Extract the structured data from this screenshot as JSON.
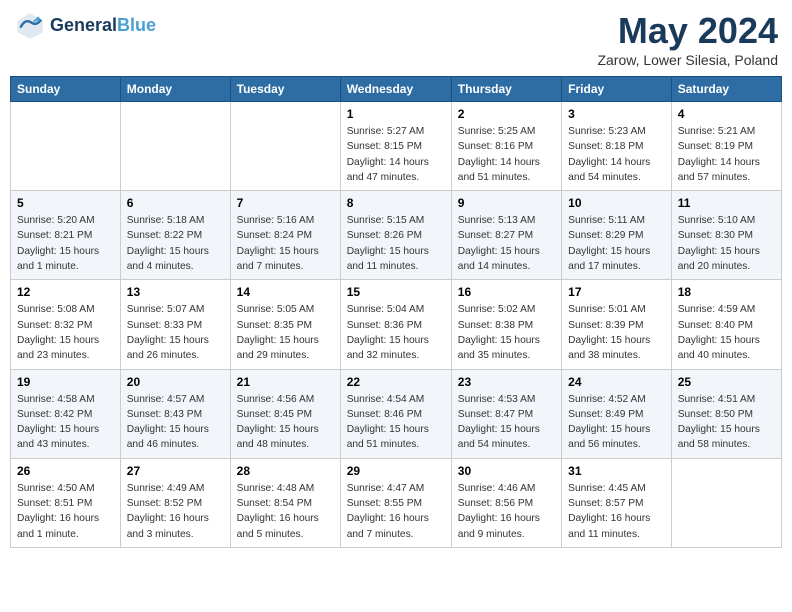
{
  "header": {
    "logo_line1": "General",
    "logo_line2": "Blue",
    "month": "May 2024",
    "location": "Zarow, Lower Silesia, Poland"
  },
  "weekdays": [
    "Sunday",
    "Monday",
    "Tuesday",
    "Wednesday",
    "Thursday",
    "Friday",
    "Saturday"
  ],
  "weeks": [
    [
      {
        "day": "",
        "info": ""
      },
      {
        "day": "",
        "info": ""
      },
      {
        "day": "",
        "info": ""
      },
      {
        "day": "1",
        "info": "Sunrise: 5:27 AM\nSunset: 8:15 PM\nDaylight: 14 hours\nand 47 minutes."
      },
      {
        "day": "2",
        "info": "Sunrise: 5:25 AM\nSunset: 8:16 PM\nDaylight: 14 hours\nand 51 minutes."
      },
      {
        "day": "3",
        "info": "Sunrise: 5:23 AM\nSunset: 8:18 PM\nDaylight: 14 hours\nand 54 minutes."
      },
      {
        "day": "4",
        "info": "Sunrise: 5:21 AM\nSunset: 8:19 PM\nDaylight: 14 hours\nand 57 minutes."
      }
    ],
    [
      {
        "day": "5",
        "info": "Sunrise: 5:20 AM\nSunset: 8:21 PM\nDaylight: 15 hours\nand 1 minute."
      },
      {
        "day": "6",
        "info": "Sunrise: 5:18 AM\nSunset: 8:22 PM\nDaylight: 15 hours\nand 4 minutes."
      },
      {
        "day": "7",
        "info": "Sunrise: 5:16 AM\nSunset: 8:24 PM\nDaylight: 15 hours\nand 7 minutes."
      },
      {
        "day": "8",
        "info": "Sunrise: 5:15 AM\nSunset: 8:26 PM\nDaylight: 15 hours\nand 11 minutes."
      },
      {
        "day": "9",
        "info": "Sunrise: 5:13 AM\nSunset: 8:27 PM\nDaylight: 15 hours\nand 14 minutes."
      },
      {
        "day": "10",
        "info": "Sunrise: 5:11 AM\nSunset: 8:29 PM\nDaylight: 15 hours\nand 17 minutes."
      },
      {
        "day": "11",
        "info": "Sunrise: 5:10 AM\nSunset: 8:30 PM\nDaylight: 15 hours\nand 20 minutes."
      }
    ],
    [
      {
        "day": "12",
        "info": "Sunrise: 5:08 AM\nSunset: 8:32 PM\nDaylight: 15 hours\nand 23 minutes."
      },
      {
        "day": "13",
        "info": "Sunrise: 5:07 AM\nSunset: 8:33 PM\nDaylight: 15 hours\nand 26 minutes."
      },
      {
        "day": "14",
        "info": "Sunrise: 5:05 AM\nSunset: 8:35 PM\nDaylight: 15 hours\nand 29 minutes."
      },
      {
        "day": "15",
        "info": "Sunrise: 5:04 AM\nSunset: 8:36 PM\nDaylight: 15 hours\nand 32 minutes."
      },
      {
        "day": "16",
        "info": "Sunrise: 5:02 AM\nSunset: 8:38 PM\nDaylight: 15 hours\nand 35 minutes."
      },
      {
        "day": "17",
        "info": "Sunrise: 5:01 AM\nSunset: 8:39 PM\nDaylight: 15 hours\nand 38 minutes."
      },
      {
        "day": "18",
        "info": "Sunrise: 4:59 AM\nSunset: 8:40 PM\nDaylight: 15 hours\nand 40 minutes."
      }
    ],
    [
      {
        "day": "19",
        "info": "Sunrise: 4:58 AM\nSunset: 8:42 PM\nDaylight: 15 hours\nand 43 minutes."
      },
      {
        "day": "20",
        "info": "Sunrise: 4:57 AM\nSunset: 8:43 PM\nDaylight: 15 hours\nand 46 minutes."
      },
      {
        "day": "21",
        "info": "Sunrise: 4:56 AM\nSunset: 8:45 PM\nDaylight: 15 hours\nand 48 minutes."
      },
      {
        "day": "22",
        "info": "Sunrise: 4:54 AM\nSunset: 8:46 PM\nDaylight: 15 hours\nand 51 minutes."
      },
      {
        "day": "23",
        "info": "Sunrise: 4:53 AM\nSunset: 8:47 PM\nDaylight: 15 hours\nand 54 minutes."
      },
      {
        "day": "24",
        "info": "Sunrise: 4:52 AM\nSunset: 8:49 PM\nDaylight: 15 hours\nand 56 minutes."
      },
      {
        "day": "25",
        "info": "Sunrise: 4:51 AM\nSunset: 8:50 PM\nDaylight: 15 hours\nand 58 minutes."
      }
    ],
    [
      {
        "day": "26",
        "info": "Sunrise: 4:50 AM\nSunset: 8:51 PM\nDaylight: 16 hours\nand 1 minute."
      },
      {
        "day": "27",
        "info": "Sunrise: 4:49 AM\nSunset: 8:52 PM\nDaylight: 16 hours\nand 3 minutes."
      },
      {
        "day": "28",
        "info": "Sunrise: 4:48 AM\nSunset: 8:54 PM\nDaylight: 16 hours\nand 5 minutes."
      },
      {
        "day": "29",
        "info": "Sunrise: 4:47 AM\nSunset: 8:55 PM\nDaylight: 16 hours\nand 7 minutes."
      },
      {
        "day": "30",
        "info": "Sunrise: 4:46 AM\nSunset: 8:56 PM\nDaylight: 16 hours\nand 9 minutes."
      },
      {
        "day": "31",
        "info": "Sunrise: 4:45 AM\nSunset: 8:57 PM\nDaylight: 16 hours\nand 11 minutes."
      },
      {
        "day": "",
        "info": ""
      }
    ]
  ]
}
